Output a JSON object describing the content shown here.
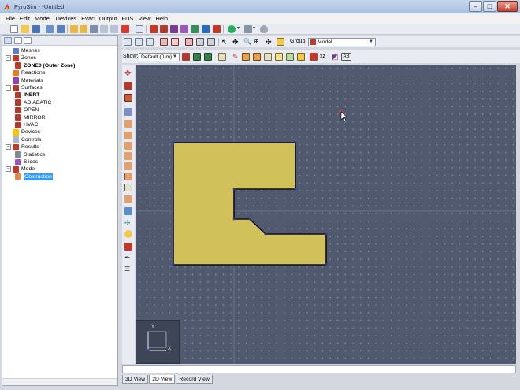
{
  "window": {
    "title": "PyroSim - *Untitled",
    "controls": {
      "minimize": "–",
      "maximize": "□",
      "close": "✕"
    }
  },
  "menu": [
    "File",
    "Edit",
    "Model",
    "Devices",
    "Evac",
    "Output",
    "FDS",
    "View",
    "Help"
  ],
  "tree": {
    "nodes": [
      {
        "label": "Meshes",
        "level": 0,
        "icon": "mesh-icon",
        "expander": "",
        "bold": false
      },
      {
        "label": "Zones",
        "level": 0,
        "icon": "zones-icon",
        "expander": "–",
        "bold": false
      },
      {
        "label": "ZONE0 (Outer Zone)",
        "level": 1,
        "icon": "zone-icon",
        "expander": "",
        "bold": true
      },
      {
        "label": "Reactions",
        "level": 0,
        "icon": "reactions-icon",
        "expander": "",
        "bold": false
      },
      {
        "label": "Materials",
        "level": 0,
        "icon": "materials-icon",
        "expander": "",
        "bold": false
      },
      {
        "label": "Surfaces",
        "level": 0,
        "icon": "surfaces-icon",
        "expander": "–",
        "bold": false
      },
      {
        "label": "INERT",
        "level": 1,
        "icon": "surface-icon",
        "expander": "",
        "bold": true
      },
      {
        "label": "ADIABATIC",
        "level": 1,
        "icon": "surface-icon",
        "expander": "",
        "bold": false
      },
      {
        "label": "OPEN",
        "level": 1,
        "icon": "surface-icon",
        "expander": "",
        "bold": false
      },
      {
        "label": "MIRROR",
        "level": 1,
        "icon": "surface-icon",
        "expander": "",
        "bold": false
      },
      {
        "label": "HVAC",
        "level": 1,
        "icon": "surface-icon",
        "expander": "",
        "bold": false
      },
      {
        "label": "Devices",
        "level": 0,
        "icon": "devices-icon",
        "expander": "",
        "bold": false
      },
      {
        "label": "Controls",
        "level": 0,
        "icon": "controls-icon",
        "expander": "",
        "bold": false
      },
      {
        "label": "Results",
        "level": 0,
        "icon": "results-icon",
        "expander": "–",
        "bold": false
      },
      {
        "label": "Statistics",
        "level": 1,
        "icon": "statistics-icon",
        "expander": "",
        "bold": false
      },
      {
        "label": "Slices",
        "level": 1,
        "icon": "slices-icon",
        "expander": "",
        "bold": false
      },
      {
        "label": "Model",
        "level": 0,
        "icon": "model-icon",
        "expander": "–",
        "bold": false
      },
      {
        "label": "Obstruction",
        "level": 1,
        "icon": "obstruction-icon",
        "expander": "",
        "bold": false,
        "selected": true
      }
    ]
  },
  "view_toolbar": {
    "group_label": "Group:",
    "group_value": "Model",
    "show_label": "Show:",
    "show_value": "Default (0 m)",
    "text_buttons": [
      "xz",
      "AB"
    ]
  },
  "viewport": {
    "axis_y": "Y",
    "axis_x": "X",
    "colors": {
      "background": "#50596e",
      "obstruction_fill": "#d1c15a",
      "obstruction_stroke": "#0b0b2a"
    }
  },
  "tabs": [
    {
      "label": "3D View",
      "active": false
    },
    {
      "label": "2D View",
      "active": true
    },
    {
      "label": "Record View",
      "active": false
    }
  ]
}
